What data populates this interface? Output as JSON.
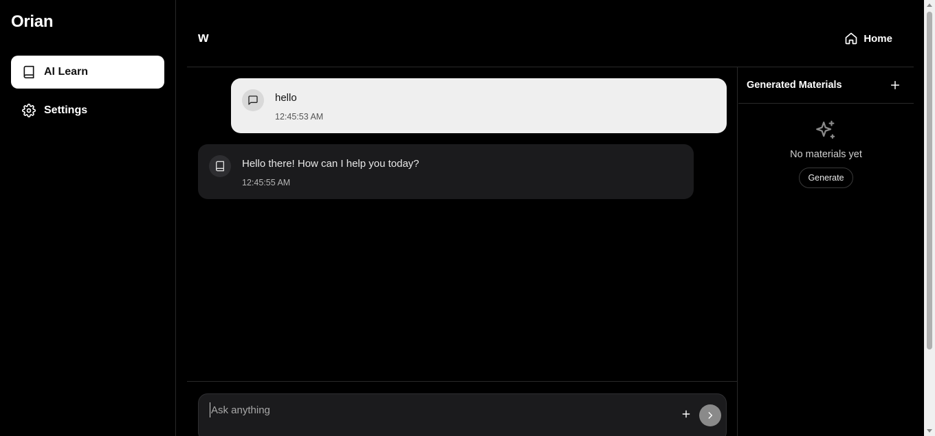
{
  "sidebar": {
    "brand": "Orian",
    "items": [
      {
        "label": "AI Learn",
        "icon": "book-icon",
        "active": true
      },
      {
        "label": "Settings",
        "icon": "gear-icon",
        "active": false
      }
    ]
  },
  "header": {
    "conversation_title": "w",
    "home_label": "Home"
  },
  "messages": [
    {
      "role": "user",
      "text": "hello",
      "time": "12:45:53 AM",
      "icon": "message-square-icon"
    },
    {
      "role": "assistant",
      "text": "Hello there! How can I help you today?",
      "time": "12:45:55 AM",
      "icon": "book-icon"
    }
  ],
  "composer": {
    "placeholder": "Ask anything"
  },
  "materials": {
    "title": "Generated Materials",
    "empty_text": "No materials yet",
    "generate_label": "Generate"
  },
  "colors": {
    "background": "#000000",
    "user_bubble": "#efefef",
    "assistant_bubble": "#1b1b1d",
    "accent_active": "#ffffff",
    "send_button": "#8a8a8a"
  }
}
